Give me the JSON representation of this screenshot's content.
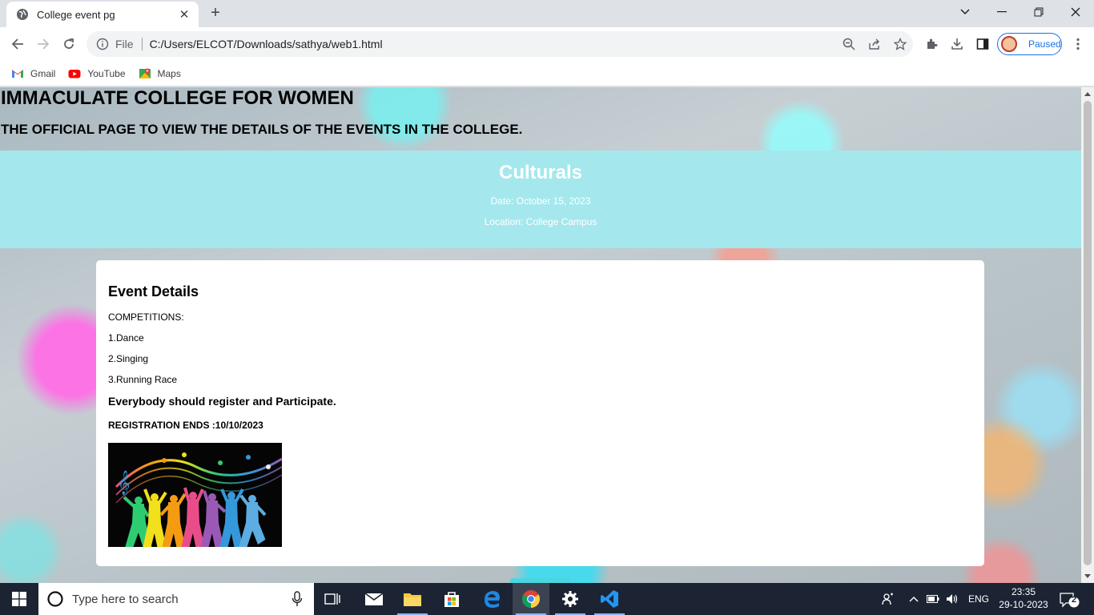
{
  "browser": {
    "tab_title": "College event pg",
    "new_tab_symbol": "+",
    "address_scheme": "File",
    "url": "C:/Users/ELCOT/Downloads/sathya/web1.html",
    "profile_status": "Paused",
    "bookmarks": [
      {
        "label": "Gmail",
        "icon": "gmail-icon"
      },
      {
        "label": "YouTube",
        "icon": "youtube-icon"
      },
      {
        "label": "Maps",
        "icon": "maps-icon"
      }
    ]
  },
  "page": {
    "title": "IMMACULATE COLLEGE FOR WOMEN",
    "subtitle": "THE OFFICIAL PAGE TO VIEW THE DETAILS OF THE EVENTS IN THE COLLEGE.",
    "banner": {
      "heading": "Culturals",
      "date": "Date: October 15, 2023",
      "location": "Location: College Campus",
      "color": "#a4e8ee"
    },
    "event": {
      "heading": "Event Details",
      "competitions_label": "COMPETITIONS:",
      "competitions": [
        "1.Dance",
        "2.Singing",
        "3.Running Race"
      ],
      "call_to_action": "Everybody should register and Participate.",
      "registration": "REGISTRATION ENDS :10/10/2023",
      "image_icon": "dancing-silhouettes-image"
    }
  },
  "taskbar": {
    "search_placeholder": "Type here to search",
    "language": "ENG",
    "time": "23:35",
    "date": "29-10-2023",
    "notifications": "2"
  }
}
